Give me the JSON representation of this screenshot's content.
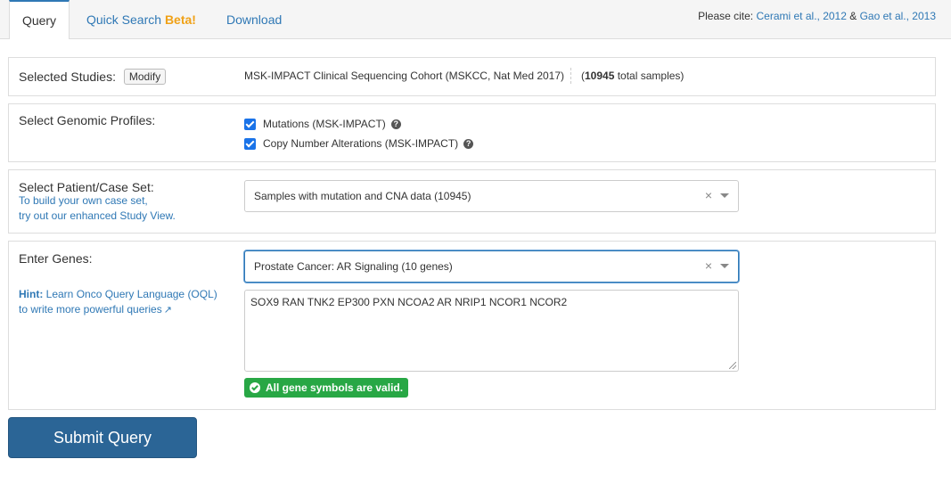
{
  "tabs": [
    {
      "label": "Query"
    },
    {
      "label": "Quick Search",
      "badge": "Beta!"
    },
    {
      "label": "Download"
    }
  ],
  "cite": {
    "prefix": "Please cite:",
    "ref1": "Cerami et al., 2012",
    "amp": "&",
    "ref2": "Gao et al., 2013"
  },
  "studies": {
    "label": "Selected Studies:",
    "modify_label": "Modify",
    "study_name": "MSK-IMPACT Clinical Sequencing Cohort (MSKCC, Nat Med 2017)",
    "total_prefix": "(",
    "total_count": "10945",
    "total_suffix": " total samples)"
  },
  "profiles": {
    "label": "Select Genomic Profiles:",
    "items": [
      {
        "label": "Mutations (MSK-IMPACT)",
        "checked": true
      },
      {
        "label": "Copy Number Alterations (MSK-IMPACT)",
        "checked": true
      }
    ]
  },
  "case_set": {
    "label": "Select Patient/Case Set:",
    "hint_line1": "To build your own case set,",
    "hint_line2": "try out our enhanced Study View.",
    "selected": "Samples with mutation and CNA data (10945)",
    "clear_symbol": "×"
  },
  "genes": {
    "label": "Enter Genes:",
    "hint_bold": "Hint:",
    "hint_text1": " Learn Onco Query Language (OQL)",
    "hint_text2": "to write more powerful queries",
    "gene_set": "Prostate Cancer: AR Signaling (10 genes)",
    "clear_symbol": "×",
    "textarea_value": "SOX9 RAN TNK2 EP300 PXN NCOA2 AR NRIP1 NCOR1 NCOR2",
    "valid_message": "All gene symbols are valid."
  },
  "submit_label": "Submit Query",
  "colors": {
    "link": "#2f78b5",
    "beta": "#f0a116",
    "checkbox": "#1a73e8",
    "valid": "#28a745",
    "submit": "#2b6596"
  },
  "icons": {
    "help": "question-circle",
    "external": "external-link",
    "valid": "check-circle",
    "dropdown": "caret-down"
  }
}
